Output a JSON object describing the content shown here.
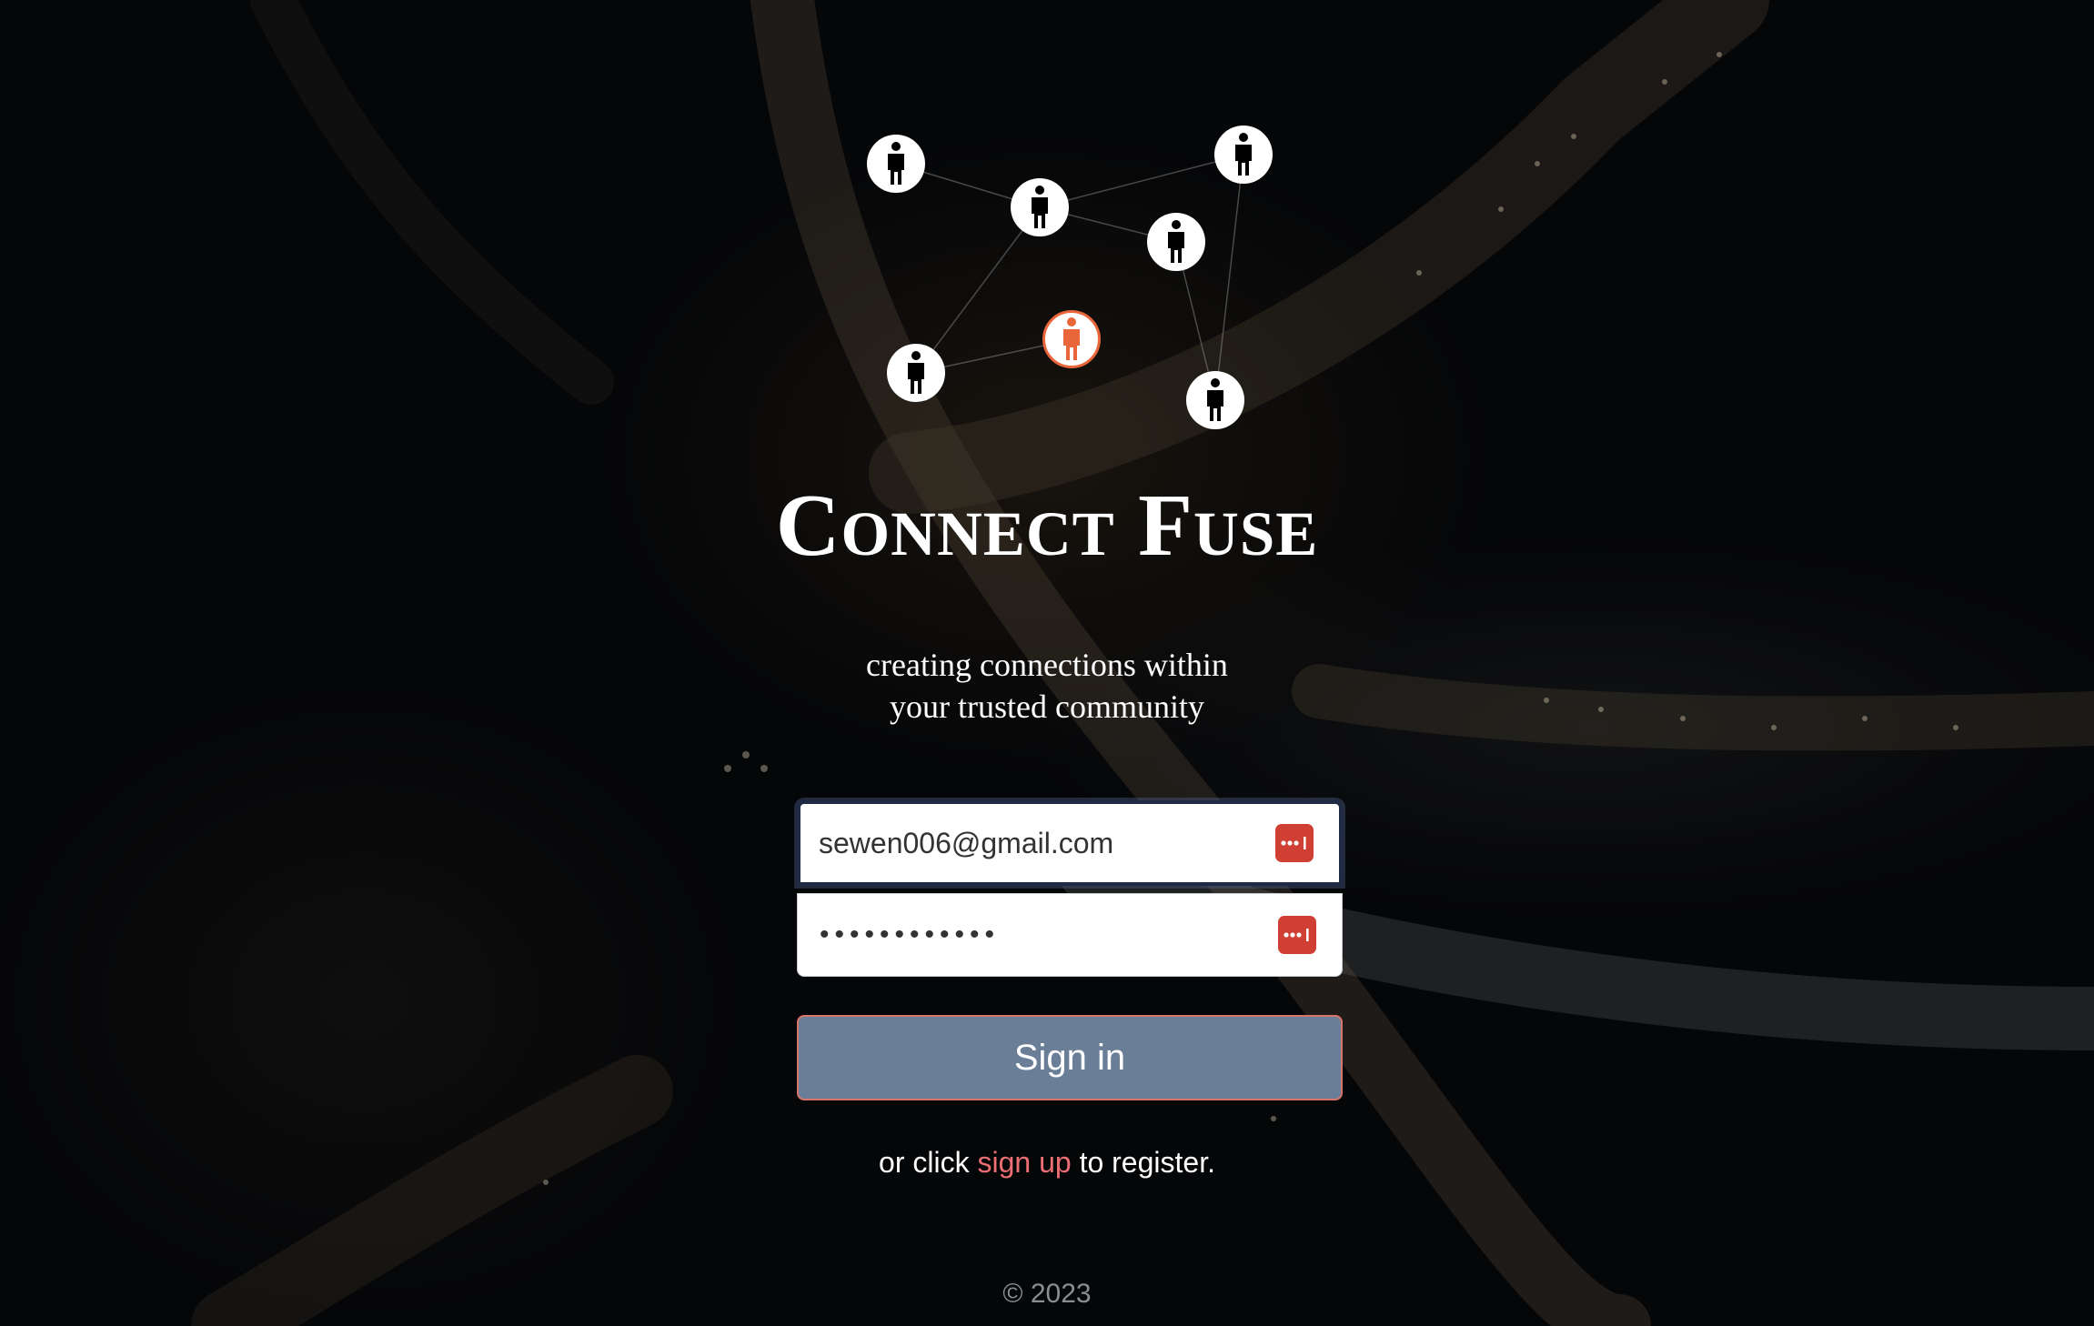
{
  "brand": {
    "title": "Connect Fuse",
    "tagline_line1": "creating connections within",
    "tagline_line2": "your trusted community"
  },
  "network_icons": {
    "people": [
      "person-icon",
      "person-icon",
      "person-icon",
      "person-icon",
      "person-icon",
      "person-icon"
    ],
    "highlighted": "person-icon",
    "highlight_color": "#e8663a"
  },
  "login_form": {
    "email_value": "sewen006@gmail.com",
    "password_value": "••••••••••••",
    "password_manager_icon": "password-manager-icon",
    "password_manager_color": "#cf3f33",
    "sign_in_label": "Sign in",
    "button_color": "#6b7e98"
  },
  "register": {
    "prefix": "or click",
    "link_label": "sign up",
    "suffix": "to register.",
    "link_color": "#ee6f73"
  },
  "footer": {
    "copyright": "© 2023"
  }
}
